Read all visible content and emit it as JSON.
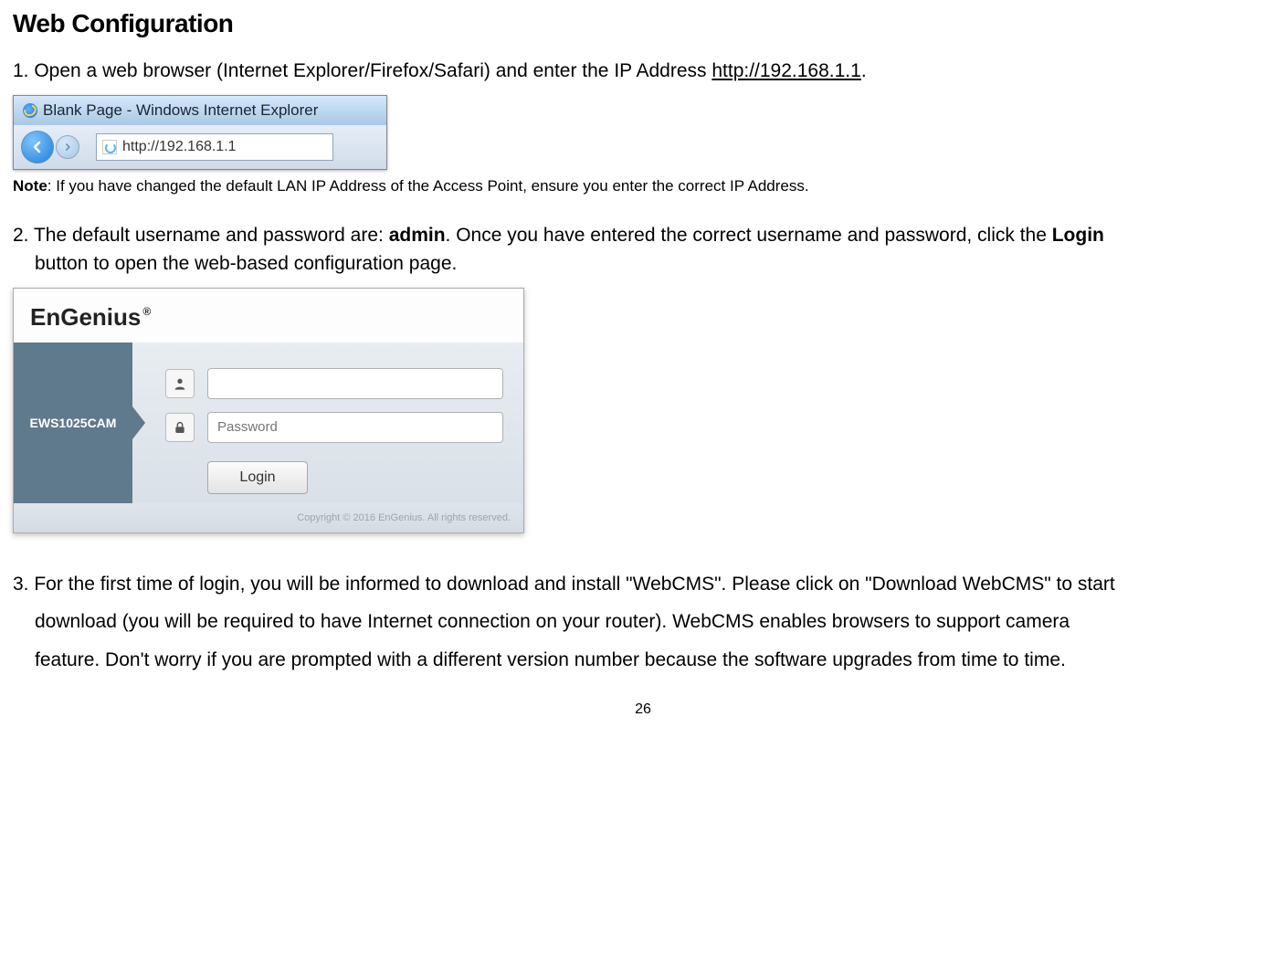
{
  "heading": "Web Configuration",
  "step1": {
    "number": "1.",
    "text_before_link": " Open a web browser (Internet Explorer/Firefox/Safari) and enter the IP Address ",
    "url": "http://192.168.1.1",
    "text_after_link": "."
  },
  "browser_mock": {
    "title": "Blank Page - Windows Internet Explorer",
    "address": "http://192.168.1.1"
  },
  "note": {
    "label": "Note",
    "text": ": If you have changed the default LAN IP Address of the Access Point, ensure you enter the correct IP Address."
  },
  "step2": {
    "number": "2.",
    "before_admin": " The default username and password are: ",
    "admin": "admin",
    "middle": ". Once you have entered the correct username and password, click the ",
    "login_word": "Login",
    "after": " button to open the web-based configuration page."
  },
  "login_mock": {
    "brand": "EnGenius",
    "reg": "®",
    "model": "EWS1025CAM",
    "password_placeholder": "Password",
    "login_button": "Login",
    "footer": "Copyright © 2016 EnGenius. All rights reserved."
  },
  "step3": {
    "number": "3.",
    "line1": " For the first time of login, you will be informed to download and install \"WebCMS\". Please click on \"Download WebCMS\" to start",
    "line2": "download (you will be required to have Internet connection on your router). WebCMS enables browsers to support camera",
    "line3": "feature. Don't worry if you are prompted with a different version number because the software upgrades from time to time."
  },
  "page_number": "26"
}
